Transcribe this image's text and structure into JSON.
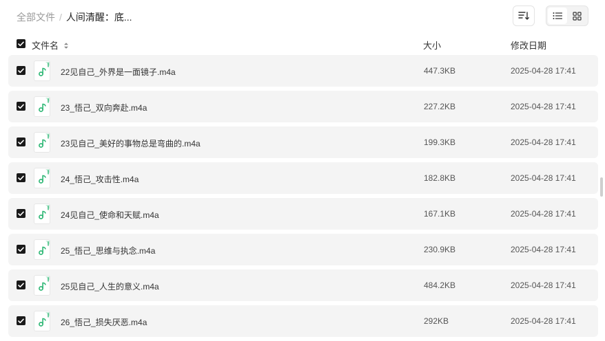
{
  "breadcrumb": {
    "root": "全部文件",
    "separator": "/",
    "current": "人间清醒：底..."
  },
  "columns": {
    "name": "文件名",
    "size": "大小",
    "modified": "修改日期"
  },
  "files": [
    {
      "name": "22见自己_外界是一面镜子.m4a",
      "size": "447.3KB",
      "modified": "2025-04-28 17:41"
    },
    {
      "name": "23_悟己_双向奔赴.m4a",
      "size": "227.2KB",
      "modified": "2025-04-28 17:41"
    },
    {
      "name": "23见自己_美好的事物总是弯曲的.m4a",
      "size": "199.3KB",
      "modified": "2025-04-28 17:41"
    },
    {
      "name": "24_悟己_攻击性.m4a",
      "size": "182.8KB",
      "modified": "2025-04-28 17:41"
    },
    {
      "name": "24见自己_使命和天赋.m4a",
      "size": "167.1KB",
      "modified": "2025-04-28 17:41"
    },
    {
      "name": "25_悟己_思维与执念.m4a",
      "size": "230.9KB",
      "modified": "2025-04-28 17:41"
    },
    {
      "name": "25见自己_人生的意义.m4a",
      "size": "484.2KB",
      "modified": "2025-04-28 17:41"
    },
    {
      "name": "26_悟己_损失厌恶.m4a",
      "size": "292KB",
      "modified": "2025-04-28 17:41"
    }
  ],
  "colors": {
    "audio_icon": "#2bb673",
    "checkbox": "#1a1a1a",
    "row_bg": "#f4f4f4"
  },
  "icons": {
    "file": "audio-file-icon",
    "sort": "sort-icon",
    "list_view": "list-view-icon",
    "grid_view": "grid-view-icon"
  }
}
